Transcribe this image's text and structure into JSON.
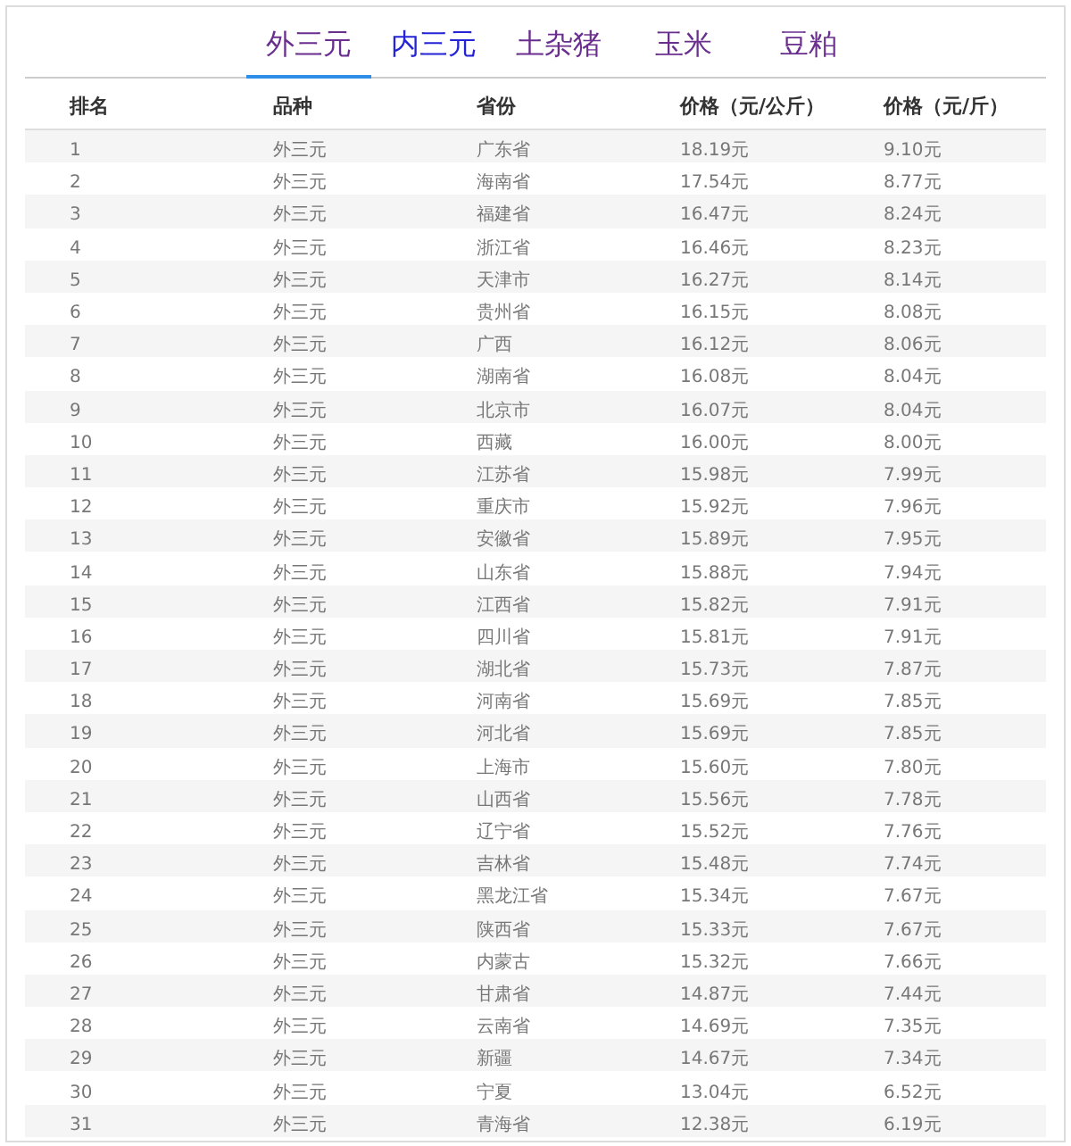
{
  "tabs": [
    {
      "label": "外三元",
      "selected": true,
      "color": "#6a2f8e"
    },
    {
      "label": "内三元",
      "selected": false,
      "color": "#2424d6"
    },
    {
      "label": "土杂猪",
      "selected": false,
      "color": "#6a2f8e"
    },
    {
      "label": "玉米",
      "selected": false,
      "color": "#6a2f8e"
    },
    {
      "label": "豆粕",
      "selected": false,
      "color": "#6a2f8e"
    }
  ],
  "table": {
    "columns": [
      "排名",
      "品种",
      "省份",
      "价格（元/公斤）",
      "价格（元/斤）"
    ],
    "rows": [
      [
        "1",
        "外三元",
        "广东省",
        "18.19元",
        "9.10元"
      ],
      [
        "2",
        "外三元",
        "海南省",
        "17.54元",
        "8.77元"
      ],
      [
        "3",
        "外三元",
        "福建省",
        "16.47元",
        "8.24元"
      ],
      [
        "4",
        "外三元",
        "浙江省",
        "16.46元",
        "8.23元"
      ],
      [
        "5",
        "外三元",
        "天津市",
        "16.27元",
        "8.14元"
      ],
      [
        "6",
        "外三元",
        "贵州省",
        "16.15元",
        "8.08元"
      ],
      [
        "7",
        "外三元",
        "广西",
        "16.12元",
        "8.06元"
      ],
      [
        "8",
        "外三元",
        "湖南省",
        "16.08元",
        "8.04元"
      ],
      [
        "9",
        "外三元",
        "北京市",
        "16.07元",
        "8.04元"
      ],
      [
        "10",
        "外三元",
        "西藏",
        "16.00元",
        "8.00元"
      ],
      [
        "11",
        "外三元",
        "江苏省",
        "15.98元",
        "7.99元"
      ],
      [
        "12",
        "外三元",
        "重庆市",
        "15.92元",
        "7.96元"
      ],
      [
        "13",
        "外三元",
        "安徽省",
        "15.89元",
        "7.95元"
      ],
      [
        "14",
        "外三元",
        "山东省",
        "15.88元",
        "7.94元"
      ],
      [
        "15",
        "外三元",
        "江西省",
        "15.82元",
        "7.91元"
      ],
      [
        "16",
        "外三元",
        "四川省",
        "15.81元",
        "7.91元"
      ],
      [
        "17",
        "外三元",
        "湖北省",
        "15.73元",
        "7.87元"
      ],
      [
        "18",
        "外三元",
        "河南省",
        "15.69元",
        "7.85元"
      ],
      [
        "19",
        "外三元",
        "河北省",
        "15.69元",
        "7.85元"
      ],
      [
        "20",
        "外三元",
        "上海市",
        "15.60元",
        "7.80元"
      ],
      [
        "21",
        "外三元",
        "山西省",
        "15.56元",
        "7.78元"
      ],
      [
        "22",
        "外三元",
        "辽宁省",
        "15.52元",
        "7.76元"
      ],
      [
        "23",
        "外三元",
        "吉林省",
        "15.48元",
        "7.74元"
      ],
      [
        "24",
        "外三元",
        "黑龙江省",
        "15.34元",
        "7.67元"
      ],
      [
        "25",
        "外三元",
        "陕西省",
        "15.33元",
        "7.67元"
      ],
      [
        "26",
        "外三元",
        "内蒙古",
        "15.32元",
        "7.66元"
      ],
      [
        "27",
        "外三元",
        "甘肃省",
        "14.87元",
        "7.44元"
      ],
      [
        "28",
        "外三元",
        "云南省",
        "14.69元",
        "7.35元"
      ],
      [
        "29",
        "外三元",
        "新疆",
        "14.67元",
        "7.34元"
      ],
      [
        "30",
        "外三元",
        "宁夏",
        "13.04元",
        "6.52元"
      ],
      [
        "31",
        "外三元",
        "青海省",
        "12.38元",
        "6.19元"
      ]
    ]
  }
}
